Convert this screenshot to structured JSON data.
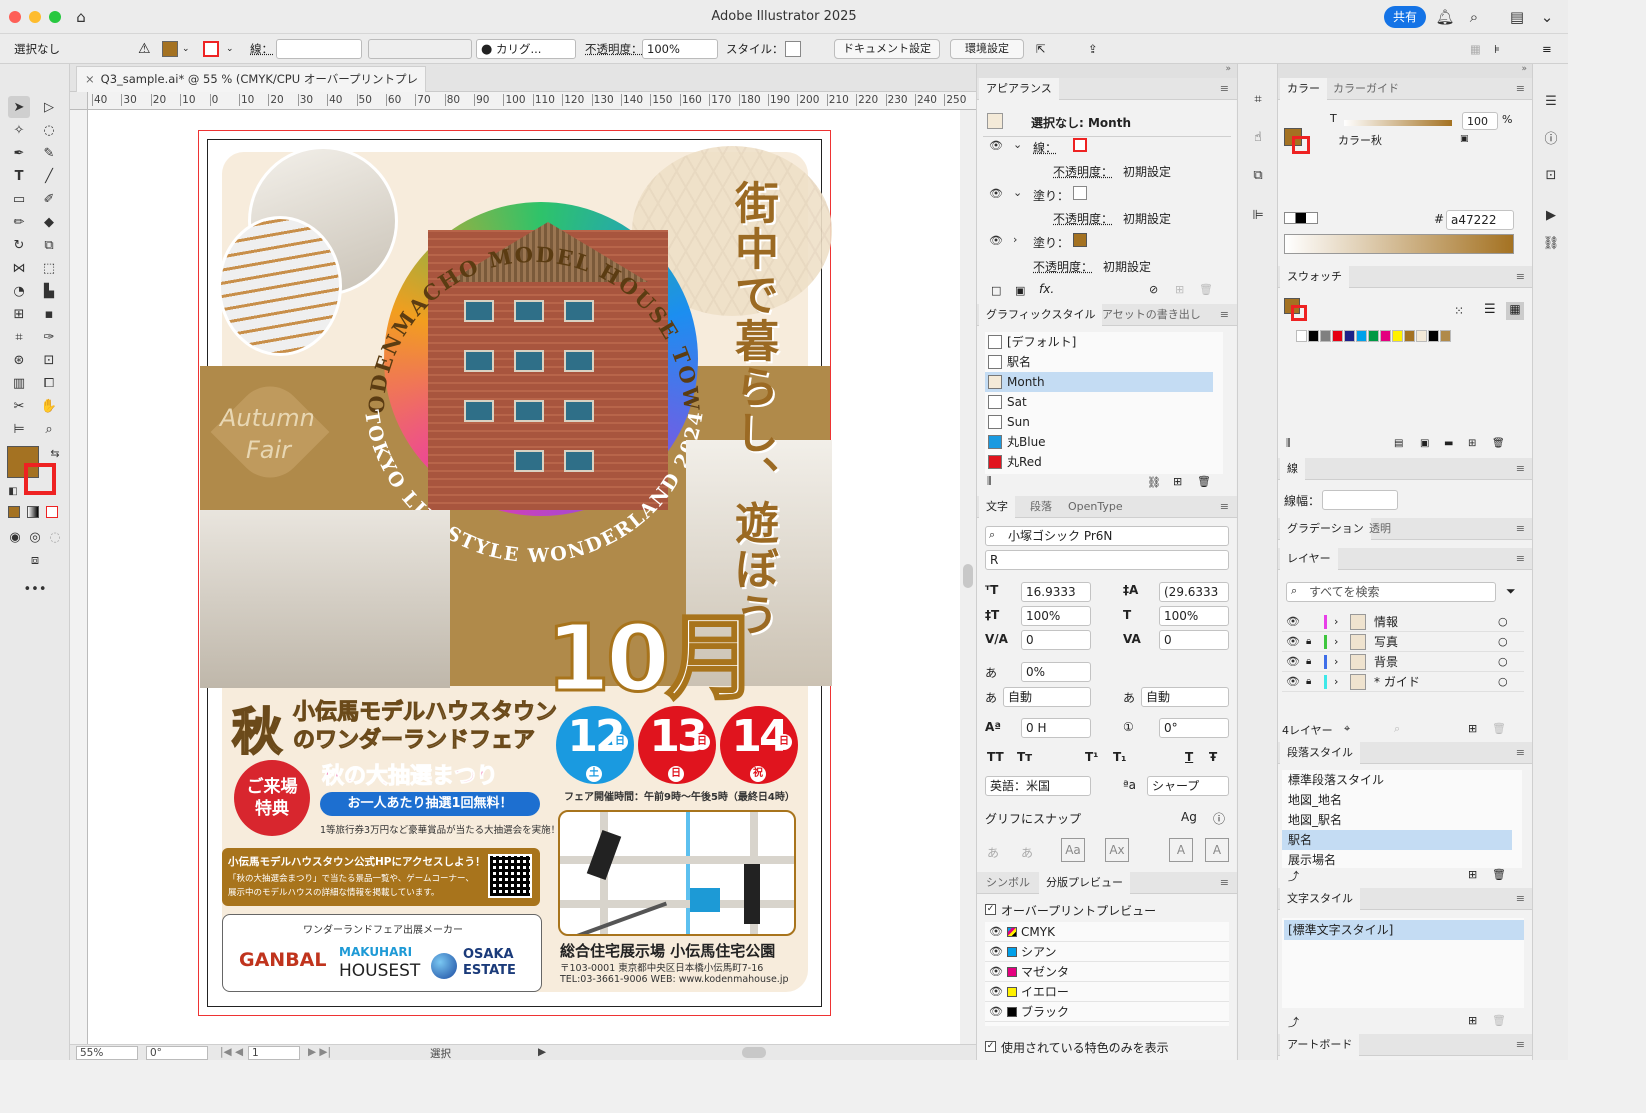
{
  "app": {
    "title": "Adobe Illustrator 2025",
    "share_label": "共有"
  },
  "control": {
    "selection": "選択なし",
    "stroke_label": "線：",
    "brush": "カリグ...",
    "opacity_label": "不透明度：",
    "opacity_value": "100%",
    "style_label": "スタイル：",
    "doc_settings": "ドキュメント設定",
    "preferences": "環境設定"
  },
  "document": {
    "tab_title": "Q3_sample.ai* @ 55 % (CMYK/CPU オーバープリントプレビュー)",
    "ruler_ticks": [
      "40",
      "30",
      "20",
      "10",
      "0",
      "10",
      "20",
      "30",
      "40",
      "50",
      "60",
      "70",
      "80",
      "90",
      "100",
      "110",
      "120",
      "130",
      "140",
      "150",
      "160",
      "170",
      "180",
      "190",
      "200",
      "210",
      "220",
      "230",
      "240",
      "250"
    ]
  },
  "poster": {
    "arc_top": "KODENMACHO MODEL HOUSE TOWN",
    "arc_bottom": "TOKYO LIFESTYLE WONDERLAND 2024",
    "vertical_1": "街中で暮らし、",
    "vertical_2": "遊ぼう",
    "autumn": "Autumn",
    "fair": "Fair",
    "month": "10月",
    "aki": "秋",
    "headline_1": "小伝馬モデルハウスタウン",
    "headline_2": "のワンダーランドフェア",
    "bonus": "ご来場特典",
    "lottery": "秋の大抽選まつり",
    "lottery_sub": "お一人あたり抽選1回無料！",
    "dates": [
      {
        "num": "12",
        "day": "日",
        "wd": "土",
        "color": "#1a9ae0"
      },
      {
        "num": "13",
        "day": "日",
        "wd": "日",
        "color": "#e0141e"
      },
      {
        "num": "14",
        "day": "日",
        "wd": "祝",
        "color": "#e0141e"
      }
    ],
    "hours": "フェア開催時間：午前9時〜午後5時（最終日4時）",
    "prize_note": "1等旅行券3万円など豪華賞品が当たる大抽選会を実施！",
    "web_1": "小伝馬モデルハウスタウン公式HPにアクセスしよう！",
    "web_2": "「秋の大抽選会まつり」で当たる景品一覧や、ゲームコーナー、",
    "web_3": "展示中のモデルハウスの詳細な情報を掲載しています。",
    "makers_title": "ワンダーランドフェア出展メーカー",
    "maker_1": "GANBAL",
    "maker_2a": "MAKUHARI",
    "maker_2b": "HOUSEST",
    "maker_3a": "OSAKA",
    "maker_3b": "ESTATE",
    "venue": "総合住宅展示場 小伝馬住宅公園",
    "address": "〒103-0001 東京都中央区日本橋小伝馬町7-16",
    "contact": "TEL:03-3661-9006 WEB: www.kodenmahouse.jp"
  },
  "status": {
    "zoom": "55%",
    "angle": "0°",
    "page": "1",
    "mode": "選択"
  },
  "appearance": {
    "title": "アピアランス",
    "header": "選択なし: Month",
    "stroke": "線：",
    "opacity1": "不透明度：",
    "opacity1_val": "初期設定",
    "fill1": "塗り：",
    "opacity2": "不透明度：",
    "opacity2_val": "初期設定",
    "fill2": "塗り：",
    "opacity3": "不透明度：",
    "opacity3_val": "初期設定",
    "fx": "fx."
  },
  "graphic_styles": {
    "tab1": "グラフィックスタイル",
    "tab2": "アセットの書き出し",
    "items": [
      "[デフォルト]",
      "駅名",
      "Month",
      "Sat",
      "Sun",
      "丸Blue",
      "丸Red"
    ],
    "selected": "Month"
  },
  "character": {
    "tab1": "文字",
    "tab2": "段落",
    "tab3": "OpenType",
    "font": "小塚ゴシック Pr6N",
    "weight": "R",
    "size": "16.9333",
    "leading": "(29.6333",
    "v_scale": "100%",
    "h_scale": "100%",
    "kerning": "0",
    "tracking": "0",
    "tsume": "0%",
    "aki_before": "自動",
    "aki_after": "自動",
    "baseline": "0 H",
    "rotation": "0°",
    "tt1": "TT",
    "tt2": "Tт",
    "tt3": "T¹",
    "tt4": "T₁",
    "tt5": "T",
    "tt6": "Ŧ",
    "language": "英語：米国",
    "aa": "ªa",
    "antialias": "シャープ",
    "snap": "グリフにスナップ"
  },
  "separations": {
    "tab1": "シンボル",
    "tab2": "分版プレビュー",
    "overprint": "オーバープリントプレビュー",
    "items": [
      {
        "name": "CMYK",
        "color": "cmyk"
      },
      {
        "name": "シアン",
        "color": "#00a0e9"
      },
      {
        "name": "マゼンタ",
        "color": "#e4007f"
      },
      {
        "name": "イエロー",
        "color": "#fff100"
      },
      {
        "name": "ブラック",
        "color": "#000000"
      }
    ],
    "only_used": "使用されている特色のみを表示"
  },
  "color": {
    "tab1": "カラー",
    "tab2": "カラーガイド",
    "t_label": "T",
    "tint": "100",
    "pct": "%",
    "name": "カラー秋",
    "hash": "#",
    "hex": "a47222",
    "hex_color": "#a47222"
  },
  "swatches": {
    "title": "スウォッチ"
  },
  "stroke_panel": {
    "title": "線",
    "weight_label": "線幅："
  },
  "gradient": {
    "tab1": "グラデーション",
    "tab2": "透明"
  },
  "layers": {
    "title": "レイヤー",
    "search": "すべてを検索",
    "items": [
      {
        "name": "情報",
        "color": "#e83ee8"
      },
      {
        "name": "写真",
        "color": "#3ec63e"
      },
      {
        "name": "背景",
        "color": "#3e6ee8"
      },
      {
        "name": "* ガイド",
        "color": "#3ee8e8"
      }
    ],
    "count": "4レイヤー"
  },
  "para_styles": {
    "title": "段落スタイル",
    "items": [
      "標準段落スタイル",
      "地図_地名",
      "地図_駅名",
      "駅名",
      "展示場名"
    ],
    "selected": "駅名"
  },
  "char_styles": {
    "title": "文字スタイル",
    "items": [
      "[標準文字スタイル]"
    ]
  },
  "artboard_panel": {
    "title": "アートボード"
  }
}
